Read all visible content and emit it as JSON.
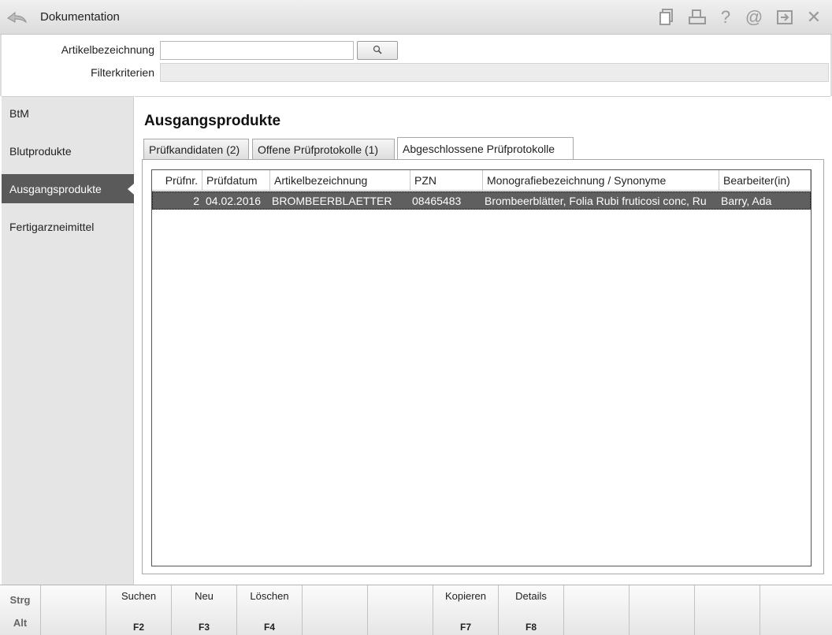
{
  "titlebar": {
    "title": "Dokumentation",
    "icons": [
      "back-icon",
      "document-icon",
      "print-icon",
      "help-icon",
      "at-icon",
      "exit-icon",
      "close-icon"
    ]
  },
  "filter": {
    "article_label": "Artikelbezeichnung",
    "article_value": "",
    "criteria_label": "Filterkriterien",
    "criteria_value": ""
  },
  "sidebar": {
    "items": [
      {
        "label": "BtM",
        "active": false
      },
      {
        "label": "Blutprodukte",
        "active": false
      },
      {
        "label": "Ausgangsprodukte",
        "active": true
      },
      {
        "label": "Fertigarzneimittel",
        "active": false
      }
    ]
  },
  "main": {
    "title": "Ausgangsprodukte",
    "tabs": [
      {
        "label": "Prüfkandidaten (2)",
        "active": false
      },
      {
        "label": "Offene Prüfprotokolle (1)",
        "active": false
      },
      {
        "label": "Abgeschlossene Prüfprotokolle",
        "active": true
      }
    ],
    "table": {
      "columns": [
        "Prüfnr.",
        "Prüfdatum",
        "Artikelbezeichnung",
        "PZN",
        "Monografiebezeichnung / Synonyme",
        "Bearbeiter(in)"
      ],
      "rows": [
        [
          "2",
          "04.02.2016",
          "BROMBEERBLAETTER",
          "08465483",
          "Brombeerblätter, Folia Rubi fruticosi conc, Ru",
          "Barry, Ada"
        ]
      ]
    }
  },
  "fkeys": {
    "modifiers": [
      "Strg",
      "Alt"
    ],
    "keys": [
      {
        "name": "",
        "key": ""
      },
      {
        "name": "Suchen",
        "key": "F2"
      },
      {
        "name": "Neu",
        "key": "F3"
      },
      {
        "name": "Löschen",
        "key": "F4"
      },
      {
        "name": "",
        "key": ""
      },
      {
        "name": "",
        "key": ""
      },
      {
        "name": "Kopieren",
        "key": "F7"
      },
      {
        "name": "Details",
        "key": "F8"
      },
      {
        "name": "",
        "key": ""
      },
      {
        "name": "",
        "key": ""
      },
      {
        "name": "",
        "key": ""
      },
      {
        "name": "",
        "key": ""
      }
    ]
  }
}
